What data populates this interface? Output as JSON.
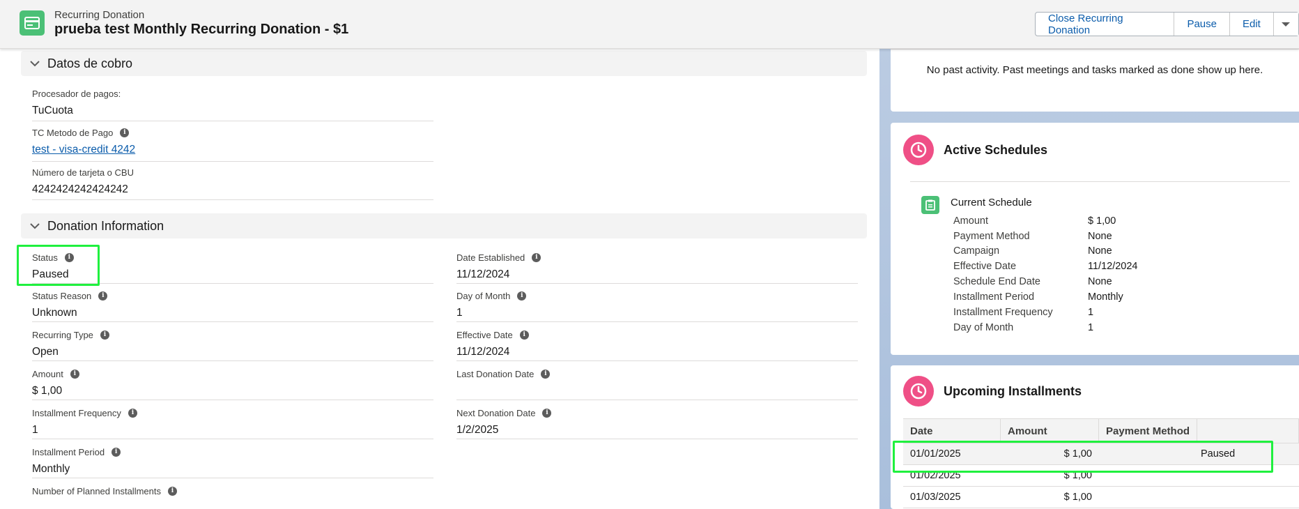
{
  "header": {
    "object_type": "Recurring Donation",
    "title": "prueba test Monthly Recurring Donation - $1",
    "buttons": [
      "Close Recurring Donation",
      "Pause",
      "Edit"
    ]
  },
  "sections": {
    "cobro": {
      "title": "Datos de cobro",
      "fields": [
        {
          "label": "Procesador de pagos:",
          "value": "TuCuota"
        },
        {
          "label": "TC Metodo de Pago",
          "value": "test - visa-credit 4242"
        },
        {
          "label": "Número de tarjeta o CBU",
          "value": "4242424242424242"
        }
      ]
    },
    "donation": {
      "title": "Donation Information",
      "left": [
        {
          "label": "Status",
          "value": "Paused"
        },
        {
          "label": "Status Reason",
          "value": "Unknown"
        },
        {
          "label": "Recurring Type",
          "value": "Open"
        },
        {
          "label": "Amount",
          "value": "$ 1,00"
        },
        {
          "label": "Installment Frequency",
          "value": "1"
        },
        {
          "label": "Installment Period",
          "value": "Monthly"
        },
        {
          "label": "Number of Planned Installments",
          "value": ""
        }
      ],
      "right": [
        {
          "label": "Date Established",
          "value": "11/12/2024"
        },
        {
          "label": "Day of Month",
          "value": "1"
        },
        {
          "label": "Effective Date",
          "value": "11/12/2024"
        },
        {
          "label": "Last Donation Date",
          "value": ""
        },
        {
          "label": "Next Donation Date",
          "value": "1/2/2025"
        }
      ]
    }
  },
  "activity": {
    "empty_text": "No past activity. Past meetings and tasks marked as done show up here."
  },
  "active_schedules": {
    "title": "Active Schedules",
    "current_label": "Current Schedule",
    "rows": [
      {
        "label": "Amount",
        "value": "$ 1,00"
      },
      {
        "label": "Payment Method",
        "value": "None"
      },
      {
        "label": "Campaign",
        "value": "None"
      },
      {
        "label": "Effective Date",
        "value": "11/12/2024"
      },
      {
        "label": "Schedule End Date",
        "value": "None"
      },
      {
        "label": "Installment Period",
        "value": "Monthly"
      },
      {
        "label": "Installment Frequency",
        "value": "1"
      },
      {
        "label": "Day of Month",
        "value": "1"
      }
    ]
  },
  "upcoming": {
    "title": "Upcoming Installments",
    "columns": [
      "Date",
      "Amount",
      "Payment Method",
      ""
    ],
    "rows": [
      {
        "date": "01/01/2025",
        "amount": "$ 1,00",
        "method": "",
        "status": "Paused"
      },
      {
        "date": "01/02/2025",
        "amount": "$ 1,00",
        "method": "",
        "status": ""
      },
      {
        "date": "01/03/2025",
        "amount": "$ 1,00",
        "method": "",
        "status": ""
      }
    ]
  },
  "colors": {
    "header_icon": "#4bc076",
    "clock_icon": "#ef4f86",
    "highlight": "#1ff03e",
    "link": "#0b5cab"
  }
}
